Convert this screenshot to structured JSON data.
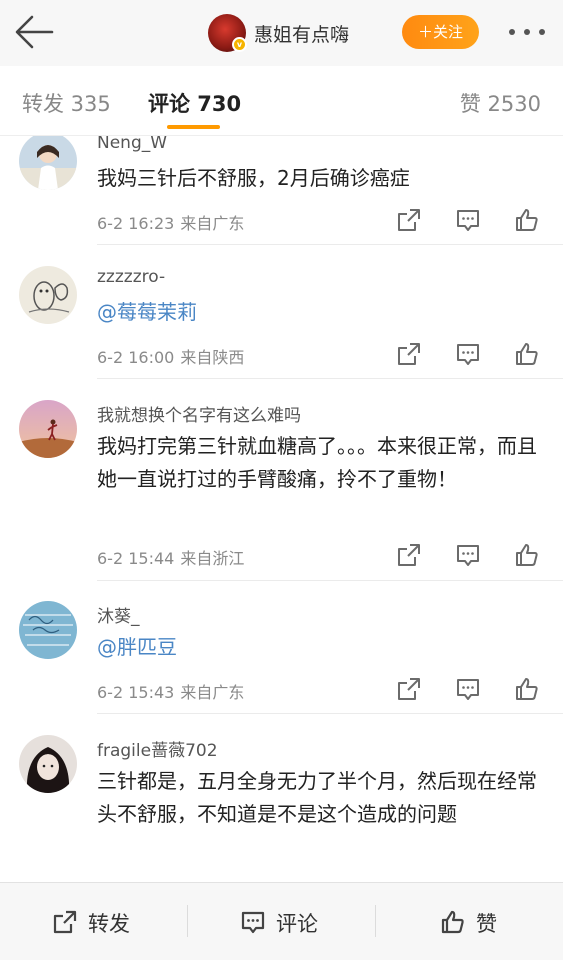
{
  "header": {
    "back_icon": "arrow-left-icon",
    "author_name": "惠姐有点嗨",
    "verified_badge": "v",
    "follow_label": "＋关注",
    "more_icon": "more-dots-icon"
  },
  "tabs": {
    "repost": "转发 335",
    "comment": "评论 730",
    "like": "赞 2530",
    "active": "comment"
  },
  "comments": [
    {
      "name": "Neng_W",
      "text": "我妈三针后不舒服，2月后确诊癌症",
      "mention": false,
      "date": "6-2 16:23",
      "location": "来自广东"
    },
    {
      "name": "zzzzzro-",
      "text": "@莓莓茉莉",
      "mention": true,
      "date": "6-2 16:00",
      "location": "来自陕西"
    },
    {
      "name": "我就想换个名字有这么难吗",
      "text": "我妈打完第三针就血糖高了。。。本来很正常，而且她一直说打过的手臂酸痛，拎不了重物！",
      "mention": false,
      "date": "6-2 15:44",
      "location": "来自浙江"
    },
    {
      "name": "沐葵_",
      "text": "@胖匹豆",
      "mention": true,
      "date": "6-2 15:43",
      "location": "来自广东"
    },
    {
      "name": "fragile蔷薇702",
      "text": "三针都是，五月全身无力了半个月，然后现在经常头不舒服，不知道是不是这个造成的问题",
      "mention": false,
      "date": "",
      "location": ""
    }
  ],
  "comment_action_icons": [
    "share-icon",
    "comment-icon",
    "like-icon"
  ],
  "footer": {
    "repost_label": "转发",
    "comment_label": "评论",
    "like_label": "赞"
  },
  "colors": {
    "accent": "#ff9a00",
    "mention": "#4a86c5",
    "meta": "#8a8a8a"
  }
}
